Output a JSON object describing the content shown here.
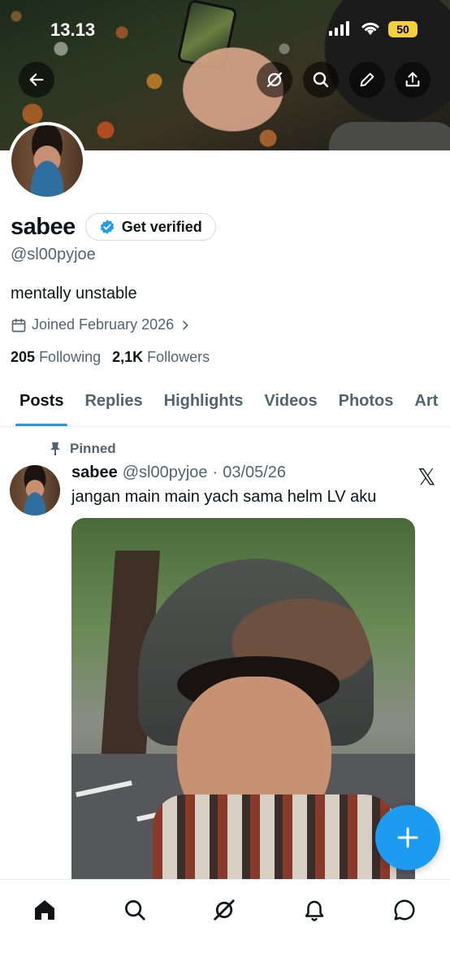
{
  "status_bar": {
    "time": "13.13",
    "battery": "50"
  },
  "banner_icons": [
    "back-arrow-icon",
    "grok-icon",
    "search-icon",
    "edit-icon",
    "share-icon"
  ],
  "profile": {
    "display_name": "sabee",
    "verify_label": "Get verified",
    "handle": "@sl00pyjoe",
    "bio": "mentally unstable",
    "joined": "Joined February 2026",
    "following_count": "205",
    "following_label": "Following",
    "followers_count": "2,1K",
    "followers_label": "Followers"
  },
  "tabs": [
    "Posts",
    "Replies",
    "Highlights",
    "Videos",
    "Photos",
    "Art"
  ],
  "active_tab": "Posts",
  "post": {
    "pinned_label": "Pinned",
    "author": "sabee",
    "handle": "@sl00pyjoe",
    "separator": "·",
    "date": "03/05/26",
    "source_glyph": "𝕏",
    "text": "jangan main main yach sama helm LV aku"
  },
  "fab": {
    "icon": "compose-plus-icon"
  },
  "bottom_nav": [
    "home-icon",
    "search-icon",
    "grok-icon",
    "notifications-icon",
    "messages-icon"
  ],
  "colors": {
    "accent": "#1d9bf0",
    "text": "#0f1419",
    "muted": "#536471",
    "battery": "#f4d03f"
  }
}
